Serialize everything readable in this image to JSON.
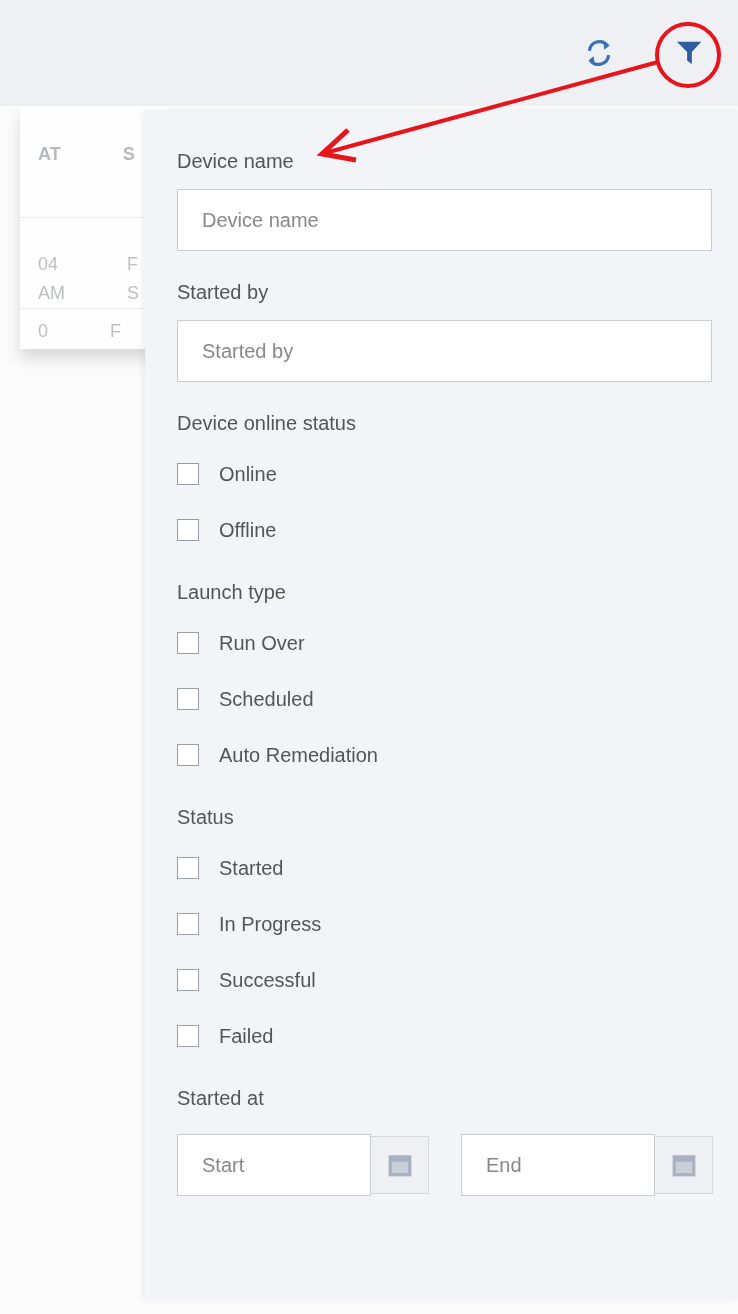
{
  "background_table": {
    "columns": [
      "AT",
      "S"
    ],
    "rows": [
      [
        "04\nAM",
        "F\nS"
      ],
      [
        "0",
        "F"
      ]
    ]
  },
  "filter_panel": {
    "sections": [
      {
        "kind": "text",
        "label": "Device name",
        "placeholder": "Device name"
      },
      {
        "kind": "text",
        "label": "Started by",
        "placeholder": "Started by"
      },
      {
        "kind": "checkboxes",
        "label": "Device online status",
        "options": [
          {
            "label": "Online",
            "checked": false
          },
          {
            "label": "Offline",
            "checked": false
          }
        ]
      },
      {
        "kind": "checkboxes",
        "label": "Launch type",
        "options": [
          {
            "label": "Run Over",
            "checked": false
          },
          {
            "label": "Scheduled",
            "checked": false
          },
          {
            "label": "Auto Remediation",
            "checked": false
          }
        ]
      },
      {
        "kind": "checkboxes",
        "label": "Status",
        "options": [
          {
            "label": "Started",
            "checked": false
          },
          {
            "label": "In Progress",
            "checked": false
          },
          {
            "label": "Successful",
            "checked": false
          },
          {
            "label": "Failed",
            "checked": false
          }
        ]
      },
      {
        "kind": "daterange",
        "label": "Started at",
        "start_placeholder": "Start",
        "end_placeholder": "End"
      }
    ]
  }
}
